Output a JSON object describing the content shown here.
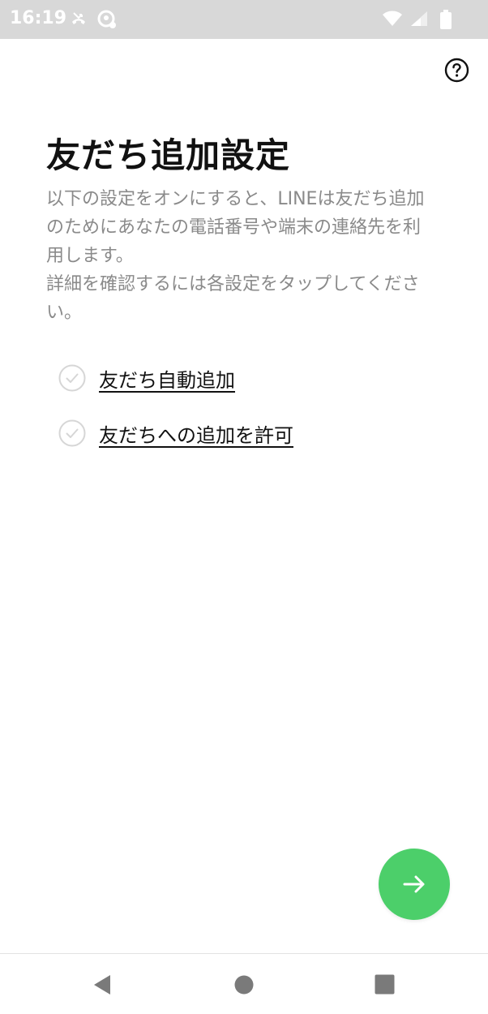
{
  "status_bar": {
    "time": "16:19",
    "icons": [
      "missed-call-icon",
      "assistant-icon",
      "wifi-icon",
      "signal-icon",
      "battery-icon"
    ]
  },
  "header": {
    "help_icon": "question-circle-icon"
  },
  "main": {
    "title": "友だち追加設定",
    "description_paragraphs": [
      "以下の設定をオンにすると、LINEは友だち追加のためにあなたの電話番号や端末の連絡先を利用します。",
      "詳細を確認するには各設定をタップしてください。"
    ],
    "settings": [
      {
        "label": "友だち自動追加",
        "icon": "check-circle-icon"
      },
      {
        "label": "友だちへの追加を許可",
        "icon": "check-circle-icon"
      }
    ]
  },
  "fab": {
    "icon": "arrow-right-icon",
    "color": "#4ccf6a"
  },
  "nav_bar": {
    "icons": [
      "back-icon",
      "home-icon",
      "recents-icon"
    ]
  }
}
